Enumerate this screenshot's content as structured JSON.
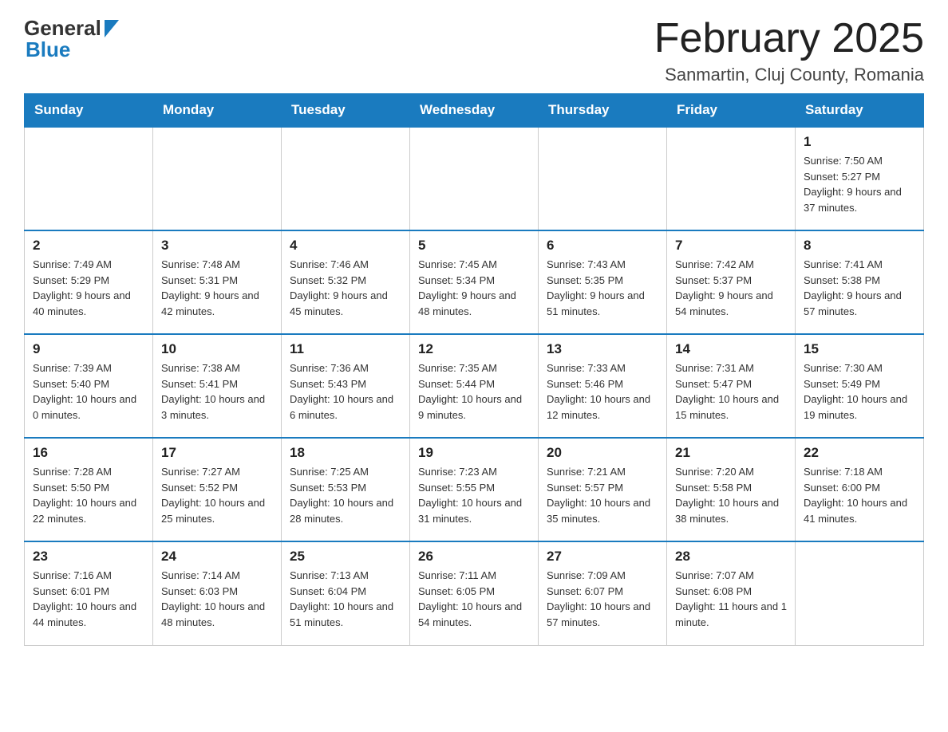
{
  "header": {
    "logo": {
      "general": "General",
      "blue": "Blue"
    },
    "title": "February 2025",
    "subtitle": "Sanmartin, Cluj County, Romania"
  },
  "weekdays": [
    "Sunday",
    "Monday",
    "Tuesday",
    "Wednesday",
    "Thursday",
    "Friday",
    "Saturday"
  ],
  "weeks": [
    [
      {
        "day": "",
        "info": ""
      },
      {
        "day": "",
        "info": ""
      },
      {
        "day": "",
        "info": ""
      },
      {
        "day": "",
        "info": ""
      },
      {
        "day": "",
        "info": ""
      },
      {
        "day": "",
        "info": ""
      },
      {
        "day": "1",
        "info": "Sunrise: 7:50 AM\nSunset: 5:27 PM\nDaylight: 9 hours and 37 minutes."
      }
    ],
    [
      {
        "day": "2",
        "info": "Sunrise: 7:49 AM\nSunset: 5:29 PM\nDaylight: 9 hours and 40 minutes."
      },
      {
        "day": "3",
        "info": "Sunrise: 7:48 AM\nSunset: 5:31 PM\nDaylight: 9 hours and 42 minutes."
      },
      {
        "day": "4",
        "info": "Sunrise: 7:46 AM\nSunset: 5:32 PM\nDaylight: 9 hours and 45 minutes."
      },
      {
        "day": "5",
        "info": "Sunrise: 7:45 AM\nSunset: 5:34 PM\nDaylight: 9 hours and 48 minutes."
      },
      {
        "day": "6",
        "info": "Sunrise: 7:43 AM\nSunset: 5:35 PM\nDaylight: 9 hours and 51 minutes."
      },
      {
        "day": "7",
        "info": "Sunrise: 7:42 AM\nSunset: 5:37 PM\nDaylight: 9 hours and 54 minutes."
      },
      {
        "day": "8",
        "info": "Sunrise: 7:41 AM\nSunset: 5:38 PM\nDaylight: 9 hours and 57 minutes."
      }
    ],
    [
      {
        "day": "9",
        "info": "Sunrise: 7:39 AM\nSunset: 5:40 PM\nDaylight: 10 hours and 0 minutes."
      },
      {
        "day": "10",
        "info": "Sunrise: 7:38 AM\nSunset: 5:41 PM\nDaylight: 10 hours and 3 minutes."
      },
      {
        "day": "11",
        "info": "Sunrise: 7:36 AM\nSunset: 5:43 PM\nDaylight: 10 hours and 6 minutes."
      },
      {
        "day": "12",
        "info": "Sunrise: 7:35 AM\nSunset: 5:44 PM\nDaylight: 10 hours and 9 minutes."
      },
      {
        "day": "13",
        "info": "Sunrise: 7:33 AM\nSunset: 5:46 PM\nDaylight: 10 hours and 12 minutes."
      },
      {
        "day": "14",
        "info": "Sunrise: 7:31 AM\nSunset: 5:47 PM\nDaylight: 10 hours and 15 minutes."
      },
      {
        "day": "15",
        "info": "Sunrise: 7:30 AM\nSunset: 5:49 PM\nDaylight: 10 hours and 19 minutes."
      }
    ],
    [
      {
        "day": "16",
        "info": "Sunrise: 7:28 AM\nSunset: 5:50 PM\nDaylight: 10 hours and 22 minutes."
      },
      {
        "day": "17",
        "info": "Sunrise: 7:27 AM\nSunset: 5:52 PM\nDaylight: 10 hours and 25 minutes."
      },
      {
        "day": "18",
        "info": "Sunrise: 7:25 AM\nSunset: 5:53 PM\nDaylight: 10 hours and 28 minutes."
      },
      {
        "day": "19",
        "info": "Sunrise: 7:23 AM\nSunset: 5:55 PM\nDaylight: 10 hours and 31 minutes."
      },
      {
        "day": "20",
        "info": "Sunrise: 7:21 AM\nSunset: 5:57 PM\nDaylight: 10 hours and 35 minutes."
      },
      {
        "day": "21",
        "info": "Sunrise: 7:20 AM\nSunset: 5:58 PM\nDaylight: 10 hours and 38 minutes."
      },
      {
        "day": "22",
        "info": "Sunrise: 7:18 AM\nSunset: 6:00 PM\nDaylight: 10 hours and 41 minutes."
      }
    ],
    [
      {
        "day": "23",
        "info": "Sunrise: 7:16 AM\nSunset: 6:01 PM\nDaylight: 10 hours and 44 minutes."
      },
      {
        "day": "24",
        "info": "Sunrise: 7:14 AM\nSunset: 6:03 PM\nDaylight: 10 hours and 48 minutes."
      },
      {
        "day": "25",
        "info": "Sunrise: 7:13 AM\nSunset: 6:04 PM\nDaylight: 10 hours and 51 minutes."
      },
      {
        "day": "26",
        "info": "Sunrise: 7:11 AM\nSunset: 6:05 PM\nDaylight: 10 hours and 54 minutes."
      },
      {
        "day": "27",
        "info": "Sunrise: 7:09 AM\nSunset: 6:07 PM\nDaylight: 10 hours and 57 minutes."
      },
      {
        "day": "28",
        "info": "Sunrise: 7:07 AM\nSunset: 6:08 PM\nDaylight: 11 hours and 1 minute."
      },
      {
        "day": "",
        "info": ""
      }
    ]
  ]
}
